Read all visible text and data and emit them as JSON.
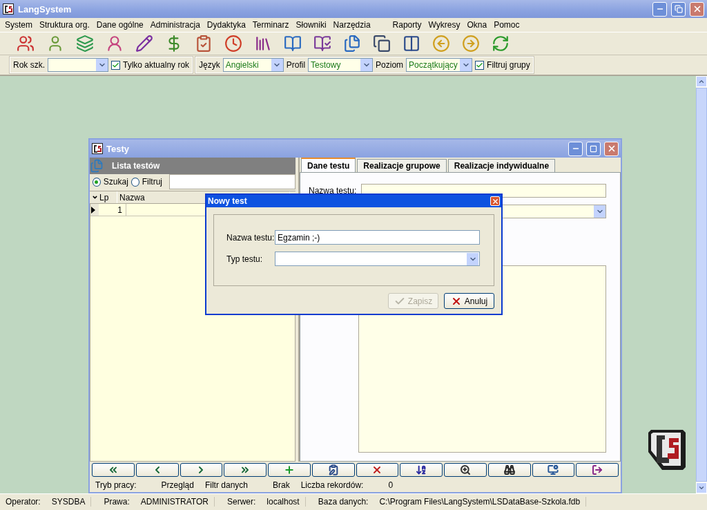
{
  "app": {
    "title": "LangSystem"
  },
  "menu": [
    "System",
    "Struktura org.",
    "Dane ogólne",
    "Administracja",
    "Dydaktyka",
    "Terminarz",
    "Słowniki",
    "Narzędzia",
    "Raporty",
    "Wykresy",
    "Okna",
    "Pomoc"
  ],
  "filter_bar": {
    "school_year": {
      "label": "Rok szk."
    },
    "current_year": {
      "label": "Tylko aktualny rok",
      "checked": true
    },
    "language": {
      "label": "Język",
      "value": "Angielski"
    },
    "profile": {
      "label": "Profil",
      "value": "Testowy"
    },
    "level": {
      "label": "Poziom",
      "value": "Początkujący"
    },
    "filter_groups": {
      "label": "Filtruj grupy",
      "checked": true
    }
  },
  "tests_window": {
    "title": "Testy",
    "list_panel": {
      "title": "Lista testów",
      "search_modes": [
        {
          "label": "Szukaj",
          "selected": true
        },
        {
          "label": "Filtruj",
          "selected": false
        }
      ],
      "columns": [
        "Lp",
        "Nazwa"
      ],
      "rows": [
        {
          "lp": "1",
          "current": true
        }
      ]
    },
    "tabs": [
      {
        "label": "Dane testu",
        "selected": true
      },
      {
        "label": "Realizacje grupowe",
        "selected": false
      },
      {
        "label": "Realizacje indywidualne",
        "selected": false
      }
    ],
    "form": {
      "name_label": "Nazwa testu:"
    },
    "status": [
      {
        "label": "Tryb pracy:",
        "value": "Przegląd"
      },
      {
        "label": "Filtr danych",
        "value": "Brak"
      },
      {
        "label": "Liczba rekordów:",
        "value": "0"
      }
    ]
  },
  "dialog": {
    "title": "Nowy test",
    "fields": [
      {
        "kind": "text",
        "label": "Nazwa testu:",
        "value": "Egzamin ;-)"
      },
      {
        "kind": "select",
        "label": "Typ testu:"
      }
    ],
    "buttons": [
      {
        "label": "Zapisz",
        "disabled": true
      },
      {
        "label": "Anuluj",
        "disabled": false
      }
    ]
  },
  "status_bar": [
    {
      "label": "Operator:",
      "value": "SYSDBA"
    },
    {
      "label": "Prawa:",
      "value": "ADMINISTRATOR"
    },
    {
      "label": "Serwer:",
      "value": "localhost"
    },
    {
      "label": "Baza danych:",
      "value": "C:\\Program Files\\LangSystem\\LSDataBase-Szkola.fdb"
    }
  ]
}
